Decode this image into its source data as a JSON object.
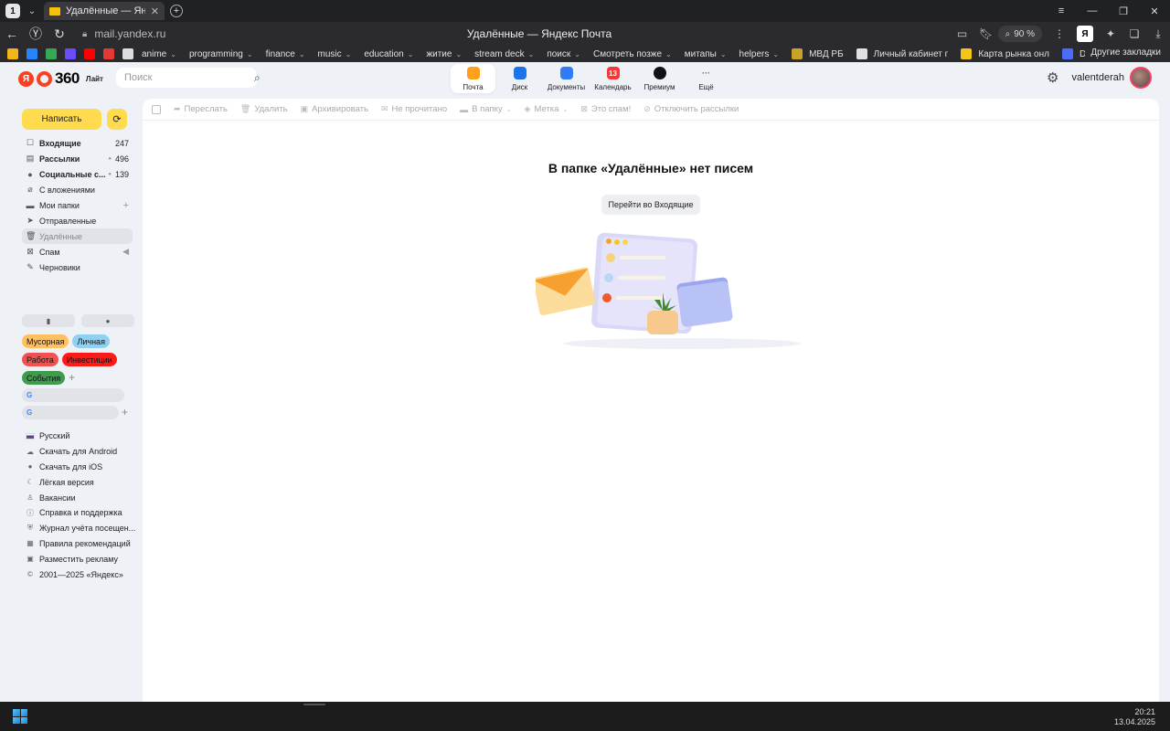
{
  "browser": {
    "tab_counter": "1",
    "tab_title": "Удалённые — Яндекс Почта",
    "url": "mail.yandex.ru",
    "page_title": "Удалённые — Яндекс Почта",
    "zoom": "90 %",
    "ya_button": "Я",
    "bookmarks": [
      {
        "label": "",
        "color": "#f3b517",
        "chev": false
      },
      {
        "label": "",
        "color": "#2684fc",
        "chev": false
      },
      {
        "label": "",
        "color": "#34a853",
        "chev": false
      },
      {
        "label": "",
        "color": "#6a4cff",
        "chev": false
      },
      {
        "label": "",
        "color": "#ff0000",
        "chev": false
      },
      {
        "label": "",
        "color": "#e53935",
        "chev": false
      },
      {
        "label": "",
        "color": "#dddddd",
        "chev": false
      },
      {
        "label": "anime",
        "color": "",
        "chev": true
      },
      {
        "label": "programming",
        "color": "",
        "chev": true
      },
      {
        "label": "finance",
        "color": "",
        "chev": true
      },
      {
        "label": "music",
        "color": "",
        "chev": true
      },
      {
        "label": "education",
        "color": "",
        "chev": true
      },
      {
        "label": "житие",
        "color": "",
        "chev": true
      },
      {
        "label": "stream deck",
        "color": "",
        "chev": true
      },
      {
        "label": "поиск",
        "color": "",
        "chev": true
      },
      {
        "label": "Смотреть позже",
        "color": "",
        "chev": true
      },
      {
        "label": "митапы",
        "color": "",
        "chev": true
      },
      {
        "label": "helpers",
        "color": "",
        "chev": true
      },
      {
        "label": "МВД РБ",
        "color": "#c9a227",
        "chev": false
      },
      {
        "label": "Личный кабинет г",
        "color": "#e0e0e0",
        "chev": false
      },
      {
        "label": "Карта рынка онл",
        "color": "#f5c518",
        "chev": false
      },
      {
        "label": "DeepSeek - Int",
        "color": "#4d6bfe",
        "chev": false
      }
    ],
    "bookmarks_other": "Другие закладки"
  },
  "header": {
    "logo_ya": "Я",
    "logo_num": "360",
    "logo_lite": "Лайт",
    "search_placeholder": "Поиск",
    "services": [
      {
        "label": "Почта",
        "color": "#ff9f1a",
        "glyph": "",
        "active": true
      },
      {
        "label": "Диск",
        "color": "#1a73e8",
        "glyph": "",
        "active": false
      },
      {
        "label": "Документы",
        "color": "#2f7cf6",
        "glyph": "",
        "active": false
      },
      {
        "label": "Календарь",
        "color": "#f33",
        "glyph": "13",
        "active": false
      },
      {
        "label": "Премиум",
        "color": "#111",
        "glyph": "",
        "active": false
      },
      {
        "label": "Ещё",
        "color": "",
        "glyph": "···",
        "active": false
      }
    ],
    "username": "valentderah"
  },
  "sidebar": {
    "compose": "Написать",
    "folders": [
      {
        "label": "Входящие",
        "count": "247",
        "bold": true,
        "icon": "☐",
        "extra": ""
      },
      {
        "label": "Рассылки",
        "count": "496",
        "bold": true,
        "icon": "▤",
        "extra": "dot"
      },
      {
        "label": "Социальные с...",
        "count": "139",
        "bold": true,
        "icon": "●",
        "extra": "dot"
      },
      {
        "label": "С вложениями",
        "count": "",
        "bold": false,
        "icon": "⌀",
        "extra": ""
      },
      {
        "label": "Мои папки",
        "count": "",
        "bold": false,
        "icon": "▬",
        "extra": "plus"
      },
      {
        "label": "Отправленные",
        "count": "",
        "bold": false,
        "icon": "➤",
        "extra": ""
      },
      {
        "label": "Удалённые",
        "count": "",
        "bold": false,
        "icon": "🗑",
        "extra": "",
        "active": true
      },
      {
        "label": "Спам",
        "count": "",
        "bold": false,
        "icon": "⊠",
        "extra": "send"
      },
      {
        "label": "Черновики",
        "count": "",
        "bold": false,
        "icon": "✎",
        "extra": ""
      }
    ],
    "labels": [
      {
        "text": "Мусорная",
        "color": "#ffc060"
      },
      {
        "text": "Личная",
        "color": "#8fd1f2"
      },
      {
        "text": "Работа",
        "color": "#f0524f"
      },
      {
        "text": "Инвестиции",
        "color": "#ff1a1a"
      },
      {
        "text": "События",
        "color": "#3f9b4e"
      }
    ],
    "footer": [
      {
        "label": "Русский",
        "icon": "flag"
      },
      {
        "label": "Скачать для Android",
        "icon": "☁"
      },
      {
        "label": "Скачать для iOS",
        "icon": "●"
      },
      {
        "label": "Лёгкая версия",
        "icon": "☾"
      },
      {
        "label": "Вакансии",
        "icon": "♙"
      },
      {
        "label": "Справка и поддержка",
        "icon": "ⓘ"
      },
      {
        "label": "Журнал учёта посещен...",
        "icon": "⛨"
      },
      {
        "label": "Правила рекомендаций",
        "icon": "▦"
      },
      {
        "label": "Разместить рекламу",
        "icon": "▣"
      },
      {
        "label": "2001—2025 «Яндекс»",
        "icon": "©"
      }
    ]
  },
  "toolbar": {
    "forward": "Переслать",
    "delete": "Удалить",
    "archive": "Архивировать",
    "unread": "Не прочитано",
    "to_folder": "В папку",
    "label": "Метка",
    "spam": "Это спам!",
    "unsubscribe": "Отключить рассылки"
  },
  "main": {
    "empty_title": "В папке «Удалённые» нет писем",
    "goto_inbox": "Перейти во Входящие"
  },
  "taskbar": {
    "time": "20:21",
    "date": "13.04.2025"
  }
}
